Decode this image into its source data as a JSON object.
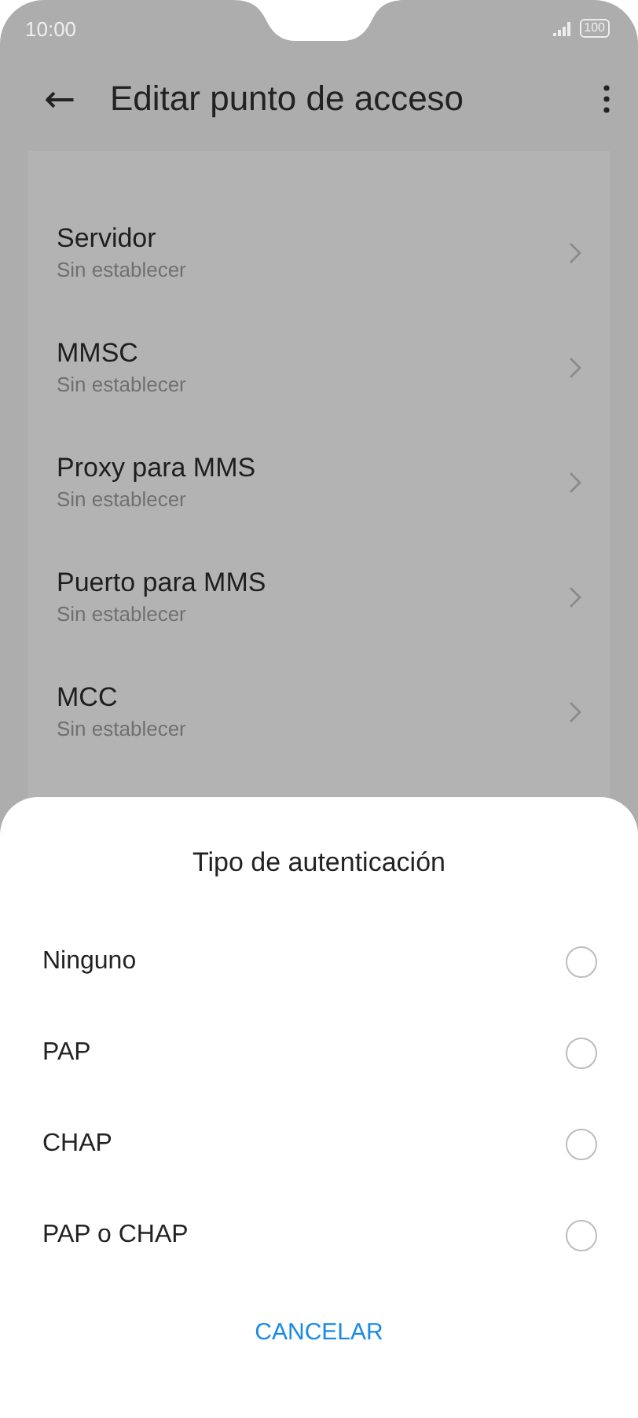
{
  "status_bar": {
    "time": "10:00",
    "battery": "100"
  },
  "header": {
    "back_icon": "←",
    "title": "Editar punto de acceso"
  },
  "settings": [
    {
      "label": "Servidor",
      "value": "Sin establecer"
    },
    {
      "label": "MMSC",
      "value": "Sin establecer"
    },
    {
      "label": "Proxy para MMS",
      "value": "Sin establecer"
    },
    {
      "label": "Puerto para MMS",
      "value": "Sin establecer"
    },
    {
      "label": "MCC",
      "value": "Sin establecer"
    }
  ],
  "dialog": {
    "title": "Tipo de autenticación",
    "options": [
      {
        "label": "Ninguno",
        "selected": false
      },
      {
        "label": "PAP",
        "selected": false
      },
      {
        "label": "CHAP",
        "selected": false
      },
      {
        "label": "PAP o CHAP",
        "selected": false
      }
    ],
    "cancel": "CANCELAR"
  }
}
